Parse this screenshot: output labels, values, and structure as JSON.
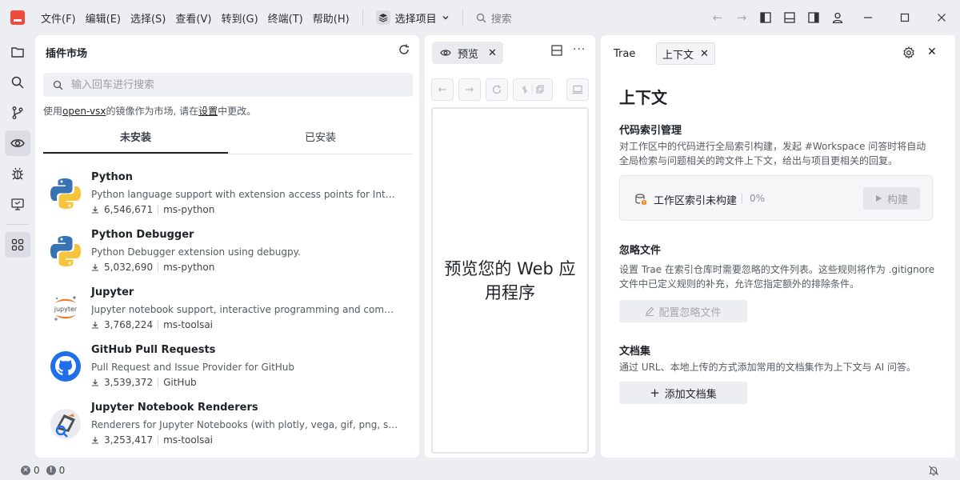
{
  "menu": [
    "文件(F)",
    "编辑(E)",
    "选择(S)",
    "查看(V)",
    "转到(G)",
    "终端(T)",
    "帮助(H)"
  ],
  "project_select": "选择项目",
  "search_label": "搜索",
  "extensions": {
    "title": "插件市场",
    "search_placeholder": "输入回车进行搜索",
    "note_prefix": "使用",
    "note_link": "open-vsx",
    "note_middle": "的镜像作为市场, 请在",
    "note_link2": "设置",
    "note_suffix": "中更改。",
    "tabs": [
      "未安装",
      "已安装"
    ],
    "items": [
      {
        "name": "Python",
        "desc": "Python language support with extension access points for IntelliSense (Pylance), Debugging (Python Debugger), linting, formatting",
        "downloads": "6,546,671",
        "publisher": "ms-python"
      },
      {
        "name": "Python Debugger",
        "desc": "Python Debugger extension using debugpy.",
        "downloads": "5,032,690",
        "publisher": "ms-python"
      },
      {
        "name": "Jupyter",
        "desc": "Jupyter notebook support, interactive programming and computing that supports Intellisense, debugging and more.",
        "downloads": "3,768,224",
        "publisher": "ms-toolsai"
      },
      {
        "name": "GitHub Pull Requests",
        "desc": "Pull Request and Issue Provider for GitHub",
        "downloads": "3,539,372",
        "publisher": "GitHub"
      },
      {
        "name": "Jupyter Notebook Renderers",
        "desc": "Renderers for Jupyter Notebooks (with plotly, vega, gif, png, svg, jpeg and other such outputs)",
        "downloads": "3,253,417",
        "publisher": "ms-toolsai"
      }
    ]
  },
  "preview": {
    "tab_label": "预览",
    "placeholder": "预览您的 Web 应用程序"
  },
  "trae": {
    "tab_trae": "Trae",
    "tab_context": "上下文",
    "title": "上下文",
    "index_title": "代码索引管理",
    "index_desc": "对工作区中的代码进行全局索引构建，发起 #Workspace 问答时将自动全局检索与问题相关的跨文件上下文，给出与项目更相关的回复。",
    "index_status": "工作区索引未构建",
    "index_percent": "0%",
    "build_label": "构建",
    "ignore_title": "忽略文件",
    "ignore_desc": "设置 Trae 在索引仓库时需要忽略的文件列表。这些规则将作为 .gitignore 文件中已定义规则的补充，允许您指定额外的排除条件。",
    "config_label": "配置忽略文件",
    "docs_title": "文档集",
    "docs_desc": "通过 URL、本地上传的方式添加常用的文档集作为上下文与 AI 问答。",
    "add_docs_label": "添加文档集"
  },
  "status": {
    "errors": "0",
    "warnings": "0"
  }
}
